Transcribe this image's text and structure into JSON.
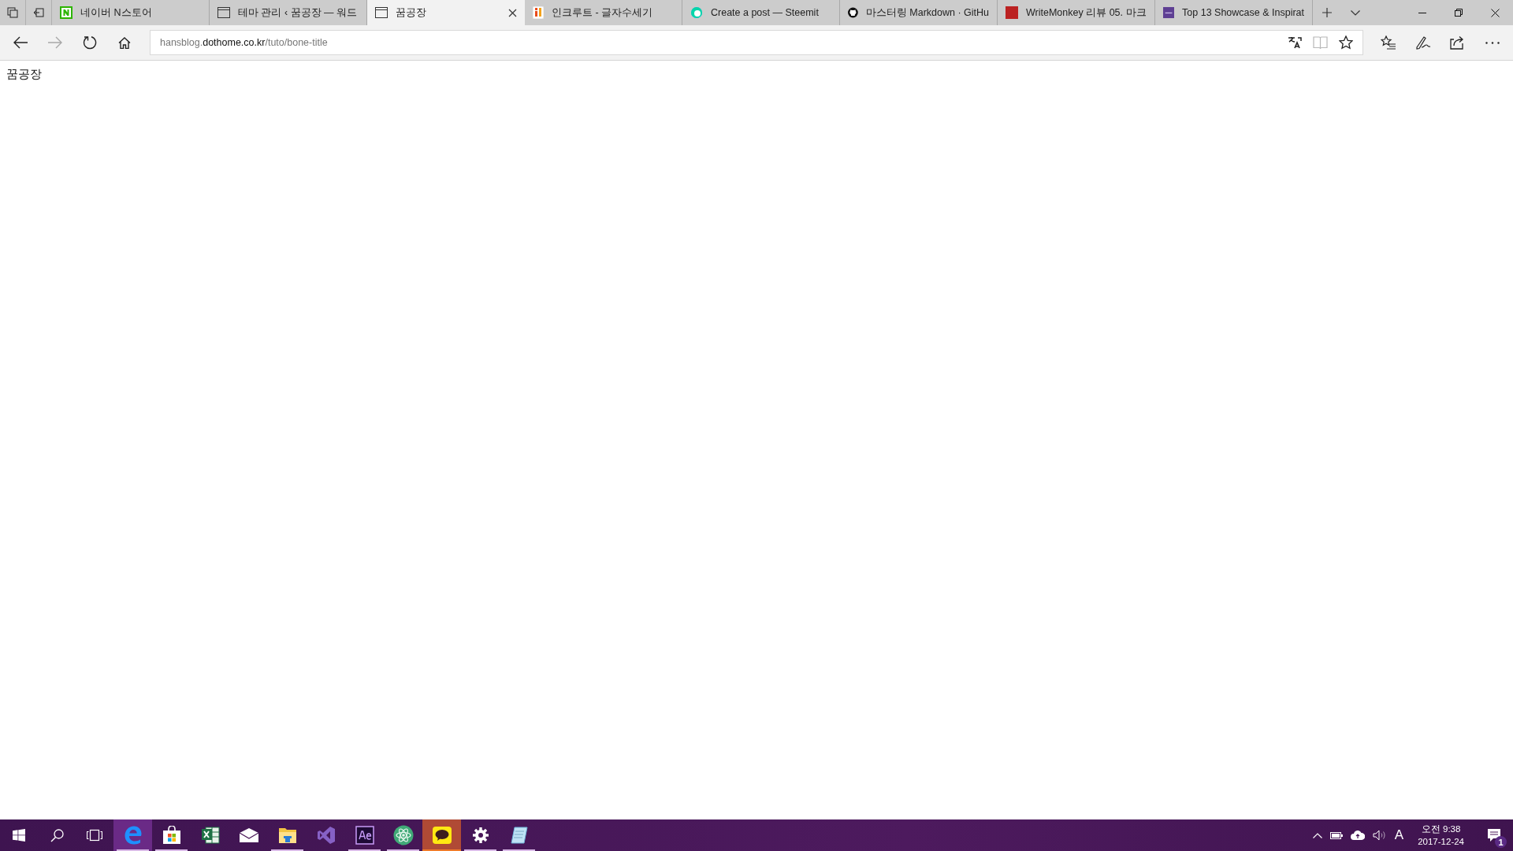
{
  "tabs": [
    {
      "title": "네이버 N스토어",
      "kind": "naver",
      "selected": false
    },
    {
      "title": "테마 관리 ‹ 꿈공장 — 워드",
      "kind": "page",
      "selected": false
    },
    {
      "title": "꿈공장",
      "kind": "page",
      "selected": true
    },
    {
      "title": "인크루트 - 글자수세기",
      "kind": "incruit",
      "selected": false
    },
    {
      "title": "Create a post — Steemit",
      "kind": "steemit",
      "selected": false
    },
    {
      "title": "마스터링 Markdown · GitHu",
      "kind": "github",
      "selected": false
    },
    {
      "title": "WriteMonkey 리뷰 05. 마크",
      "kind": "photo",
      "selected": false
    },
    {
      "title": "Top 13 Showcase & Inspirat",
      "kind": "colorlib",
      "selected": false
    }
  ],
  "address_bar": {
    "subdomain": "hansblog.",
    "domain": "dothome.co.kr",
    "path": "/tuto/bone-title"
  },
  "toolbar": {
    "forward_disabled": true,
    "reading_view_disabled": true
  },
  "page": {
    "text": "꿈공장"
  },
  "taskbar": {
    "apps": [
      {
        "kind": "edge",
        "running": true,
        "active": true,
        "flashing": false
      },
      {
        "kind": "store",
        "running": true,
        "active": false,
        "flashing": false
      },
      {
        "kind": "excel",
        "running": false,
        "active": false,
        "flashing": false
      },
      {
        "kind": "mail",
        "running": false,
        "active": false,
        "flashing": false
      },
      {
        "kind": "explorer",
        "running": true,
        "active": false,
        "flashing": false
      },
      {
        "kind": "visualstudio",
        "running": false,
        "active": false,
        "flashing": false
      },
      {
        "kind": "aftereffects",
        "running": true,
        "active": false,
        "flashing": false
      },
      {
        "kind": "atom",
        "running": true,
        "active": false,
        "flashing": false
      },
      {
        "kind": "kakaotalk",
        "running": true,
        "active": false,
        "flashing": true
      },
      {
        "kind": "settings",
        "running": true,
        "active": false,
        "flashing": false
      },
      {
        "kind": "notepad",
        "running": true,
        "active": false,
        "flashing": false
      }
    ],
    "input_indicator": "A",
    "time": "오전 9:38",
    "date": "2017-12-24",
    "notifications": "1"
  }
}
